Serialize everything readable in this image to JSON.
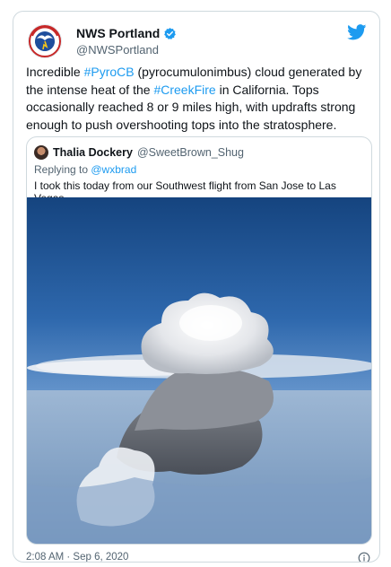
{
  "tweet": {
    "author_name": "NWS Portland",
    "author_handle": "@NWSPortland",
    "text_parts": [
      {
        "text": "Incredible ",
        "tag": false
      },
      {
        "text": "#PyroCB",
        "tag": true
      },
      {
        "text": " (pyrocumulonimbus) cloud generated by the intense heat of the ",
        "tag": false
      },
      {
        "text": "#CreekFire",
        "tag": true
      },
      {
        "text": " in California.  Tops occasionally reached 8 or 9 miles high, with updrafts strong enough to push overshooting tops into the stratosphere.",
        "tag": false
      }
    ],
    "timestamp": "2:08 AM · Sep 6, 2020"
  },
  "quote": {
    "author_name": "Thalia Dockery",
    "author_handle": "@SweetBrown_Shug",
    "replying_prefix": "Replying to ",
    "replying_to": "@wxbrad",
    "text": "I took this today from our Southwest flight from San Jose to Las Vegas"
  },
  "colors": {
    "accent": "#1d9bf0",
    "text": "#0f1419",
    "muted": "#536471",
    "border": "#cfd9de"
  },
  "icons": {
    "verified": "verified-badge-icon",
    "brand": "twitter-bird-icon",
    "info": "info-icon"
  }
}
